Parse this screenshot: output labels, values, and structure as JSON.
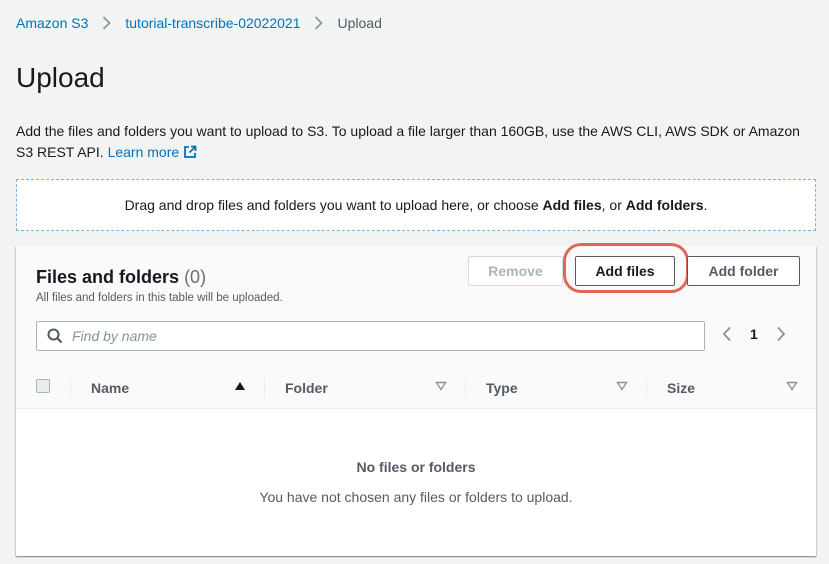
{
  "breadcrumb": {
    "items": [
      "Amazon S3",
      "tutorial-transcribe-02022021"
    ],
    "current": "Upload"
  },
  "page": {
    "title": "Upload",
    "description": "Add the files and folders you want to upload to S3. To upload a file larger than 160GB, use the AWS CLI, AWS SDK or Amazon S3 REST API.",
    "learn_more": "Learn more"
  },
  "dropzone": {
    "text_prefix": "Drag and drop files and folders you want to upload here, or choose ",
    "add_files": "Add files",
    "sep": ", or ",
    "add_folders": "Add folders",
    "suffix": "."
  },
  "files_panel": {
    "title": "Files and folders",
    "count": "(0)",
    "subtitle": "All files and folders in this table will be uploaded.",
    "buttons": {
      "remove": "Remove",
      "add_files": "Add files",
      "add_folder": "Add folder"
    },
    "search_placeholder": "Find by name",
    "page_number": "1",
    "columns": [
      "Name",
      "Folder",
      "Type",
      "Size"
    ],
    "empty_title": "No files or folders",
    "empty_message": "You have not chosen any files or folders to upload."
  },
  "colors": {
    "link": "#0073bb",
    "highlight": "#e0665a"
  },
  "icons": [
    "chevron-right-icon",
    "external-link-icon",
    "search-icon",
    "chevron-left-icon",
    "sort-ascending-icon",
    "sort-descending-icon"
  ]
}
